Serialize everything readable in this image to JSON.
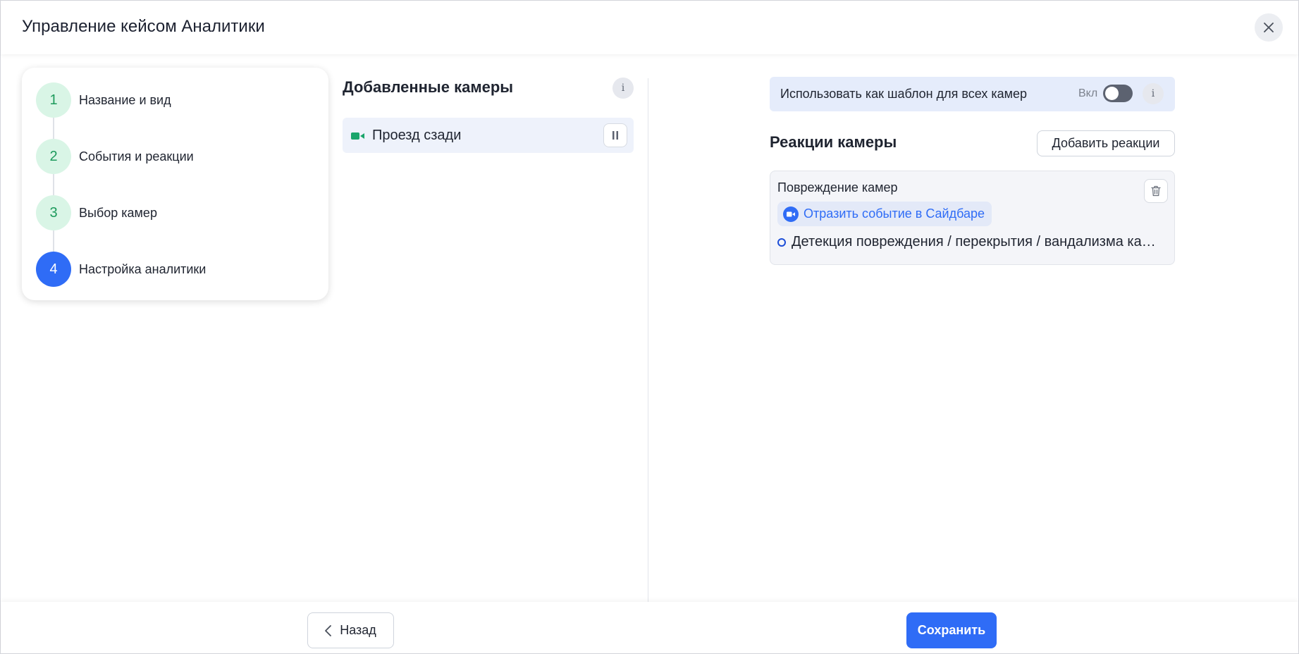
{
  "header": {
    "title": "Управление кейсом Аналитики"
  },
  "stepper": {
    "steps": [
      {
        "num": "1",
        "label": "Название и вид",
        "state": "completed"
      },
      {
        "num": "2",
        "label": "События и реакции",
        "state": "completed"
      },
      {
        "num": "3",
        "label": "Выбор камер",
        "state": "completed"
      },
      {
        "num": "4",
        "label": "Настройка аналитики",
        "state": "active"
      }
    ]
  },
  "cameras": {
    "title": "Добавленные камеры",
    "info": "i",
    "items": [
      {
        "label": "Проезд сзади",
        "icon": "video-camera-icon"
      }
    ]
  },
  "template": {
    "label": "Использовать как шаблон для всех камер",
    "toggle_label": "Вкл",
    "toggle_on": false,
    "info": "i"
  },
  "reactions": {
    "title": "Реакции камеры",
    "add_button": "Добавить реакции",
    "cards": [
      {
        "title": "Повреждение камер",
        "chip": "Отразить событие в Сайдбаре",
        "detection": "Детекция повреждения / перекрытия / вандализма камеры"
      }
    ]
  },
  "footer": {
    "back_label": "Назад",
    "save_label": "Сохранить"
  },
  "colors": {
    "accent": "#2f6cf6",
    "step_done_bg": "#d9f5e6",
    "step_done_text": "#1d9a5c",
    "camera_icon": "#1aa56b"
  }
}
